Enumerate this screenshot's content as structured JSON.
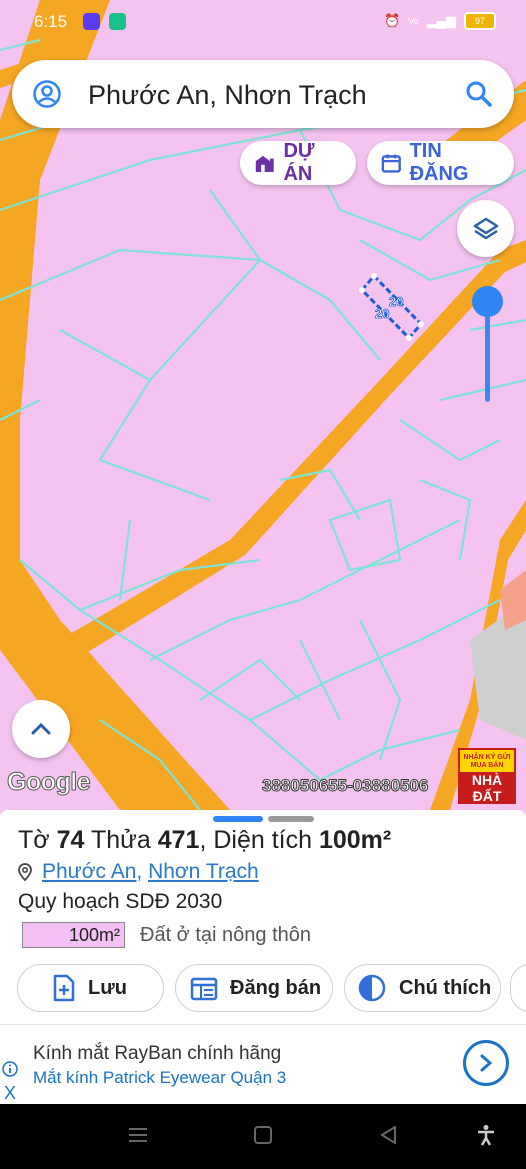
{
  "status": {
    "time": "6:15",
    "battery": "97"
  },
  "search": {
    "query": "Phước An, Nhơn Trạch"
  },
  "chips": {
    "project": "DỰ ÁN",
    "listing": "TIN ĐĂNG"
  },
  "map": {
    "parcel_labels": [
      "20",
      "20"
    ],
    "provider": "Google",
    "watermark_phone": "388050655-03880506",
    "badge_line1": "NHẬN KÝ GỬI MUA BÁN",
    "badge_line2": "NHÀ ĐẤT"
  },
  "parcel": {
    "sheet_label": "Tờ",
    "sheet_no": "74",
    "plot_label": "Thửa",
    "plot_no": "471",
    "area_label": ", Diện tích",
    "area_value": "100m²",
    "ward": "Phước An",
    "district": "Nhơn Trạch",
    "plan_title": "Quy hoạch SDĐ 2030",
    "plan_area": "100m²",
    "land_type": "Đất ở tại nông thôn"
  },
  "actions": {
    "save": "Lưu",
    "sell": "Đăng bán",
    "legend": "Chú thích"
  },
  "ad": {
    "title": "Kính mắt RayBan chính hãng",
    "subtitle": "Mắt kính Patrick Eyewear Quận 3",
    "close": "X"
  },
  "colors": {
    "land": "#f5c3f0",
    "road": "#f5a623",
    "parcel_line": "#7fe3d6",
    "accent": "#2f85f3"
  }
}
